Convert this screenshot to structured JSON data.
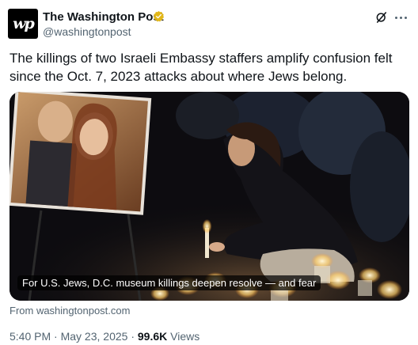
{
  "author": {
    "avatar_text": "wp",
    "name": "The Washington Post",
    "handle": "@washingtonpost",
    "verified_color": "#e2b719"
  },
  "tweet": {
    "text": "The killings of two Israeli Embassy staffers amplify confusion felt since the Oct. 7, 2023 attacks about where Jews belong."
  },
  "card": {
    "caption": "For U.S. Jews, D.C. museum killings deepen resolve — and fear",
    "source": "From washingtonpost.com"
  },
  "meta": {
    "time": "5:40 PM",
    "separator": " · ",
    "date": "May 23, 2025",
    "views_count": "99.6K",
    "views_label": "Views"
  },
  "icons": {
    "grok": "grok-icon",
    "more": "more-icon",
    "verified": "verified-badge-icon"
  }
}
